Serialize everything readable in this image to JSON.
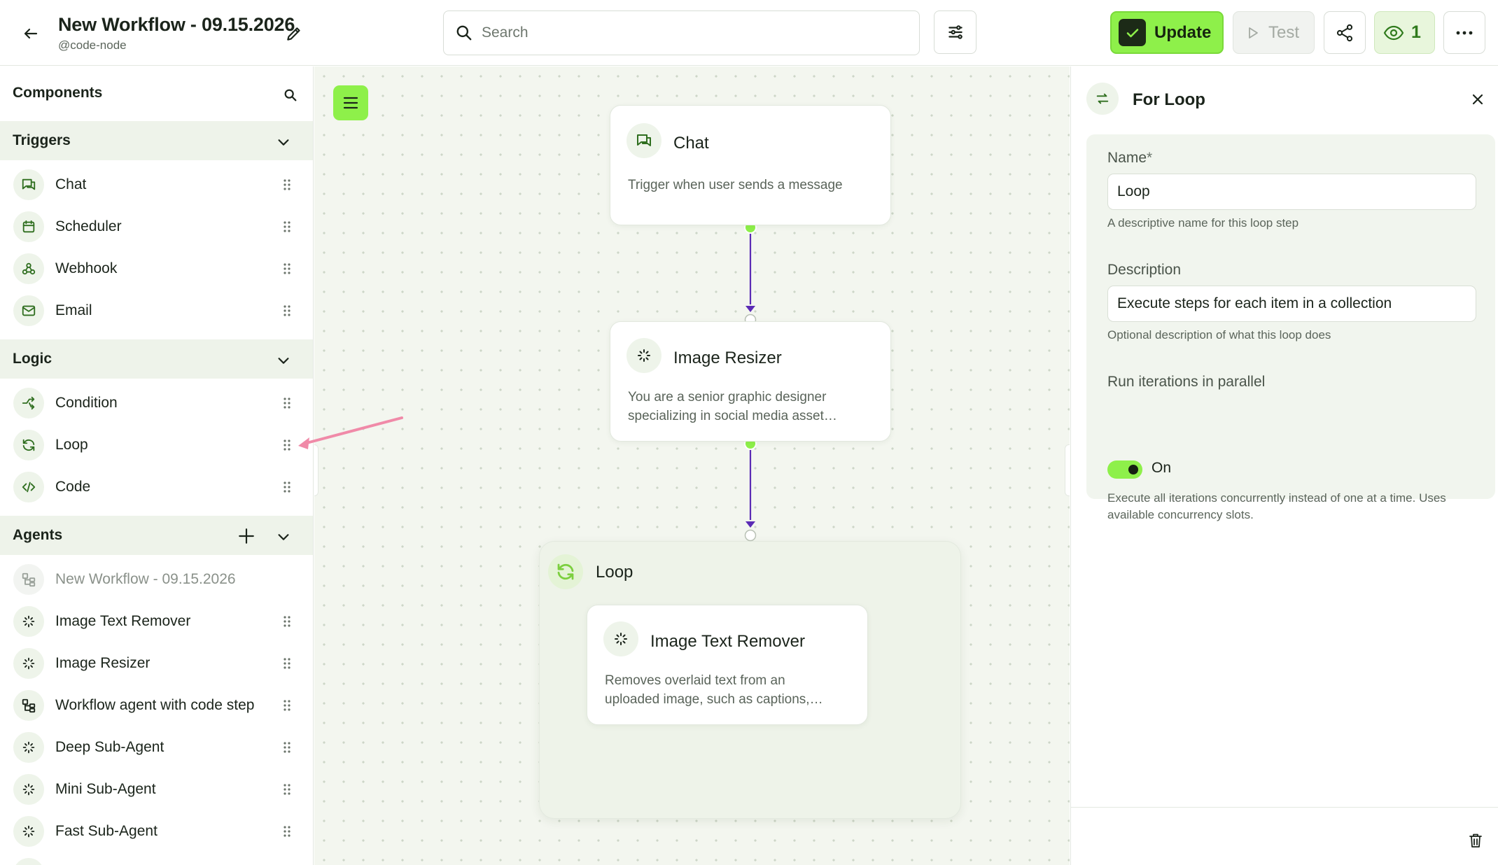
{
  "header": {
    "title": "New Workflow - 09.15.2026",
    "subtitle": "@code-node",
    "search_placeholder": "Search",
    "update_label": "Update",
    "test_label": "Test",
    "viewers_count": "1"
  },
  "sidebar": {
    "title": "Components",
    "sections": {
      "triggers": {
        "label": "Triggers",
        "items": [
          {
            "label": "Chat",
            "icon": "chat-icon"
          },
          {
            "label": "Scheduler",
            "icon": "calendar-icon"
          },
          {
            "label": "Webhook",
            "icon": "webhook-icon"
          },
          {
            "label": "Email",
            "icon": "mail-icon"
          }
        ]
      },
      "logic": {
        "label": "Logic",
        "items": [
          {
            "label": "Condition",
            "icon": "branch-icon"
          },
          {
            "label": "Loop",
            "icon": "loop-icon"
          },
          {
            "label": "Code",
            "icon": "code-icon"
          }
        ]
      },
      "agents": {
        "label": "Agents",
        "items": [
          {
            "label": "New Workflow - 09.15.2026",
            "icon": "workflow-icon",
            "disabled": true
          },
          {
            "label": "Image Text Remover",
            "icon": "sparkle-icon"
          },
          {
            "label": "Image Resizer",
            "icon": "sparkle-icon"
          },
          {
            "label": "Workflow agent with code step",
            "icon": "workflow-icon"
          },
          {
            "label": "Deep Sub-Agent",
            "icon": "sparkle-icon"
          },
          {
            "label": "Mini Sub-Agent",
            "icon": "sparkle-icon"
          },
          {
            "label": "Fast Sub-Agent",
            "icon": "sparkle-icon"
          }
        ]
      }
    }
  },
  "canvas": {
    "nodes": {
      "chat": {
        "title": "Chat",
        "description": "Trigger when user sends a message"
      },
      "resizer": {
        "title": "Image Resizer",
        "description": "You are a senior graphic designer specializing in social media asset…"
      },
      "loop": {
        "title": "Loop"
      },
      "remover": {
        "title": "Image Text Remover",
        "description": "Removes overlaid text from an uploaded image, such as captions,…"
      }
    }
  },
  "panel": {
    "title": "For Loop",
    "name_label": "Name",
    "name_required": "*",
    "name_value": "Loop",
    "name_help": "A descriptive name for this loop step",
    "description_label": "Description",
    "description_value": "Execute steps for each item in a collection",
    "description_help": "Optional description of what this loop does",
    "parallel_label": "Run iterations in parallel",
    "parallel_state": "On",
    "parallel_help": "Execute all iterations concurrently instead of one at a time. Uses available concurrency slots."
  },
  "colors": {
    "accent": "#8ef04a",
    "edge": "#5b2bb5",
    "annotation_arrow": "#f08aa8"
  }
}
